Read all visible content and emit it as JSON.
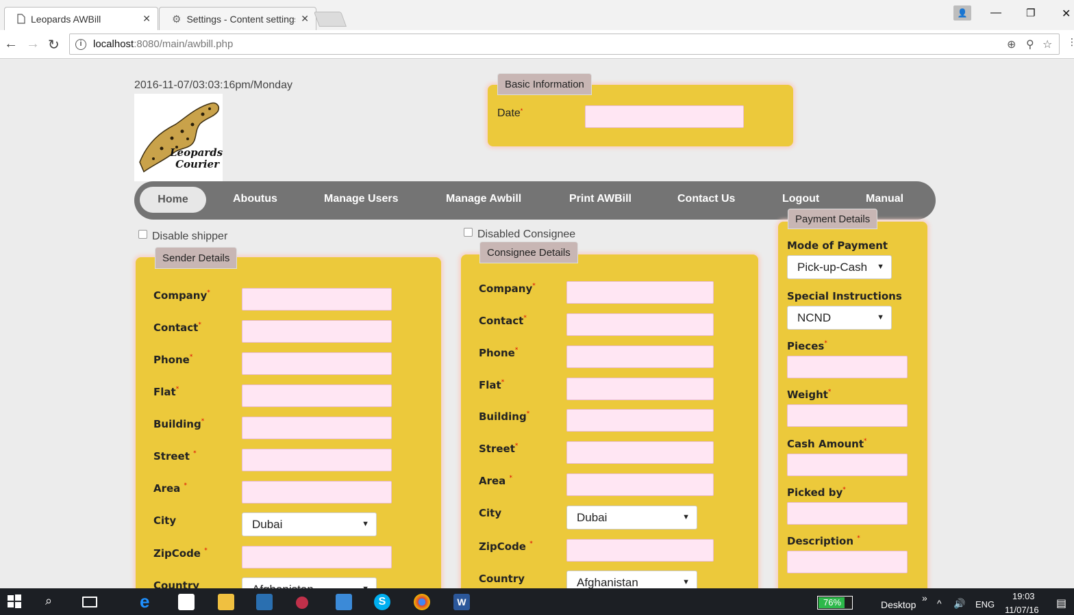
{
  "browser": {
    "tabs": [
      {
        "title": "Leopards AWBill",
        "active": true
      },
      {
        "title": "Settings - Content settings",
        "active": false
      }
    ],
    "url_host": "localhost",
    "url_path": ":8080/main/awbill.php"
  },
  "page": {
    "datetime": "2016-11-07/03:03:16pm/Monday",
    "logo_text": "Leopards Courier",
    "basic_info": {
      "legend": "Basic Information",
      "date_label": "Date"
    },
    "nav": [
      "Home",
      "Aboutus",
      "Manage Users",
      "Manage Awbill",
      "Print AWBill",
      "Contact Us",
      "Logout",
      "Manual"
    ],
    "disable_shipper": "Disable shipper",
    "disabled_consignee": "Disabled Consignee",
    "sender": {
      "legend": "Sender Details",
      "fields": [
        "Company",
        "Contact",
        "Phone",
        "Flat",
        "Building",
        "Street ",
        "Area ",
        "City",
        "ZipCode ",
        "Country"
      ],
      "city_value": "Dubai",
      "country_value": "Afghanistan"
    },
    "consignee": {
      "legend": "Consignee Details",
      "fields": [
        "Company",
        "Contact",
        "Phone",
        "Flat",
        "Building",
        "Street",
        "Area ",
        "City",
        "ZipCode ",
        "Country"
      ],
      "city_value": "Dubai",
      "country_value": "Afghanistan"
    },
    "payment": {
      "legend": "Payment Details",
      "mode_label": "Mode of Payment",
      "mode_value": "Pick-up-Cash",
      "special_label": "Special Instructions",
      "special_value": "NCND",
      "pieces_label": "Pieces",
      "weight_label": "Weight",
      "cash_label": "Cash Amount",
      "picked_label": "Picked by",
      "description_label": "Description "
    }
  },
  "taskbar": {
    "battery": "76%",
    "desktop": "Desktop",
    "lang": "ENG",
    "time": "19:03",
    "date": "11/07/16"
  },
  "colors": {
    "panel": "#ecc93b",
    "nav": "#747474",
    "input": "#ffe6f3"
  }
}
